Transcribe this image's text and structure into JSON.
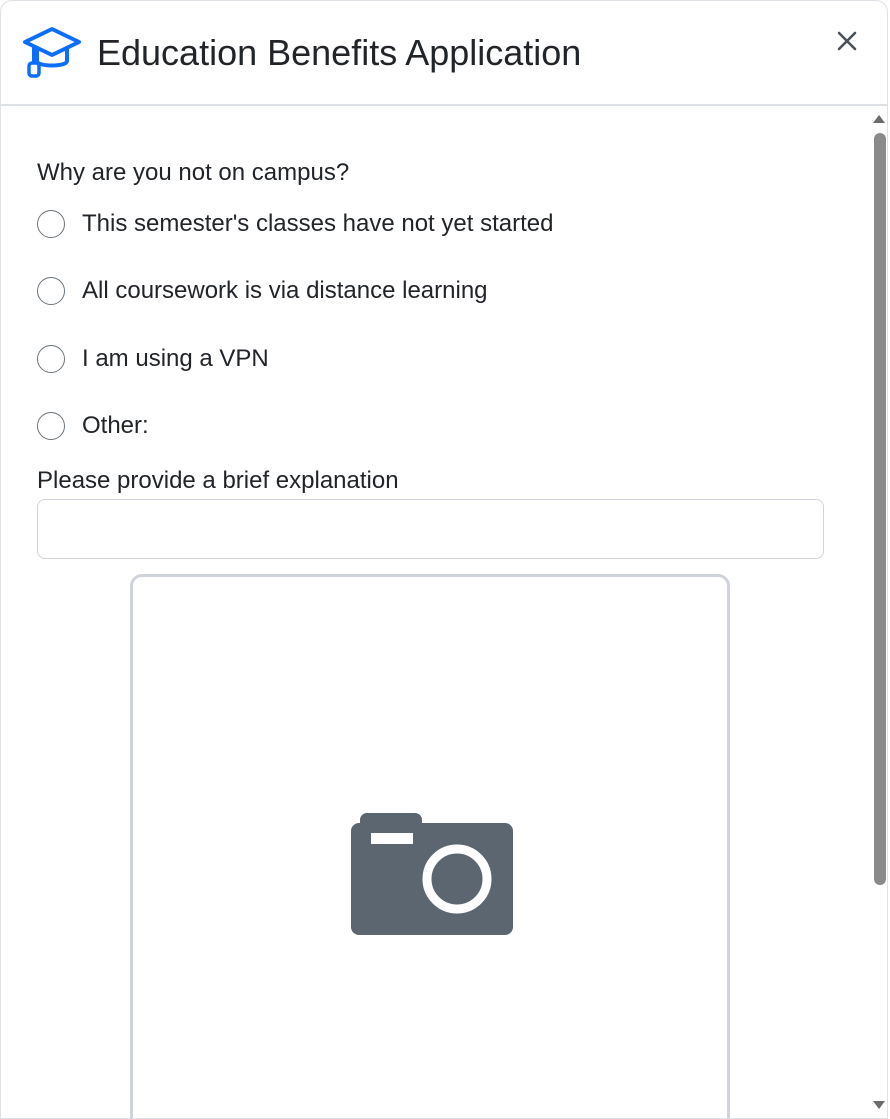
{
  "dialog": {
    "title": "Education Benefits Application",
    "title_icon": "graduation-cap-icon",
    "close_icon": "close-icon"
  },
  "form": {
    "question": "Why are you not on campus?",
    "options": [
      "This semester's classes have not yet started",
      "All coursework is via distance learning",
      "I am using a VPN",
      "Other:"
    ],
    "selected_option": null,
    "explanation_label": "Please provide a brief explanation",
    "explanation_value": "",
    "photo_upload_icon": "camera-icon"
  },
  "colors": {
    "accent": "#0d6efd",
    "camera_icon": "#5c6670",
    "scrollbar_thumb": "#8a8a8a"
  }
}
